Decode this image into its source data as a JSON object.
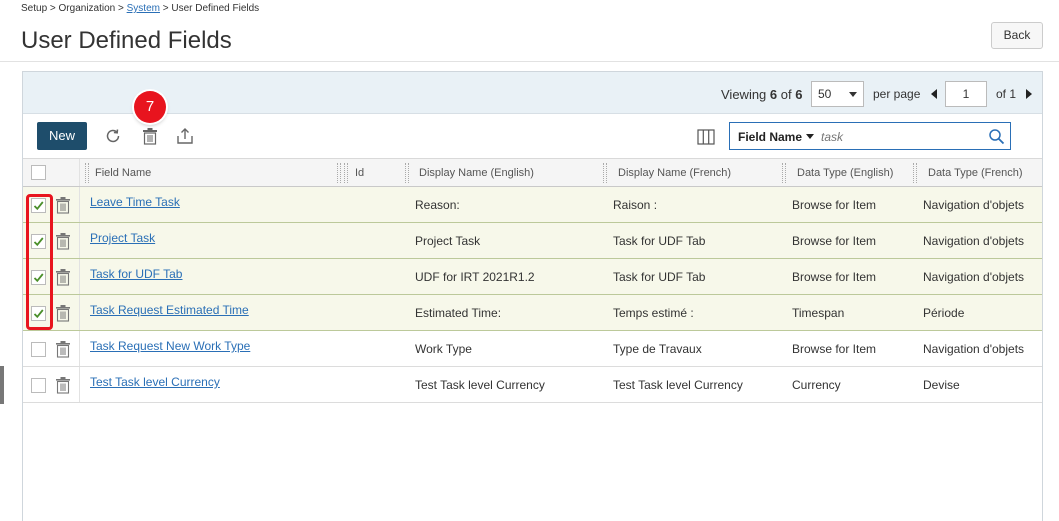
{
  "breadcrumb": {
    "part1": "Setup > Organization > ",
    "link": "System",
    "part2": " > User Defined Fields"
  },
  "page_title": "User Defined Fields",
  "back_label": "Back",
  "pager": {
    "viewing_prefix": "Viewing",
    "viewing_count": "6",
    "of_word": "of",
    "viewing_total": "6",
    "per_page_value": "50",
    "per_page_label": "per page",
    "page_value": "1",
    "of_pages": "of 1"
  },
  "toolbar": {
    "new_label": "New",
    "badge": "7",
    "icons": [
      "refresh-icon",
      "delete-icon",
      "export-icon",
      "columns-icon"
    ]
  },
  "search": {
    "field_label": "Field Name",
    "placeholder": "task"
  },
  "columns": [
    "Field Name",
    "Id",
    "Display Name (English)",
    "Display Name (French)",
    "Data Type (English)",
    "Data Type (French)"
  ],
  "rows": [
    {
      "selected": true,
      "field_name": "Leave Time Task",
      "id": "",
      "display_en": "Reason:",
      "display_fr": "Raison :",
      "type_en": "Browse for Item",
      "type_fr": "Navigation d'objets"
    },
    {
      "selected": true,
      "field_name": "Project Task",
      "id": "",
      "display_en": "Project Task",
      "display_fr": "Task for UDF Tab",
      "type_en": "Browse for Item",
      "type_fr": "Navigation d'objets"
    },
    {
      "selected": true,
      "field_name": "Task for UDF Tab",
      "id": "",
      "display_en": "UDF for IRT 2021R1.2",
      "display_fr": "Task for UDF Tab",
      "type_en": "Browse for Item",
      "type_fr": "Navigation d'objets"
    },
    {
      "selected": true,
      "field_name": "Task Request Estimated Time",
      "id": "",
      "display_en": "Estimated Time:",
      "display_fr": "Temps estimé :",
      "type_en": "Timespan",
      "type_fr": "Période"
    },
    {
      "selected": false,
      "field_name": "Task Request New Work Type",
      "id": "",
      "display_en": "Work Type",
      "display_fr": "Type de Travaux",
      "type_en": "Browse for Item",
      "type_fr": "Navigation d'objets"
    },
    {
      "selected": false,
      "field_name": "Test Task level Currency",
      "id": "",
      "display_en": "Test Task level Currency",
      "display_fr": "Test Task level Currency",
      "type_en": "Currency",
      "type_fr": "Devise"
    }
  ],
  "colors": {
    "accent": "#1e4d6b",
    "link": "#2a6fb6",
    "highlight": "#e8141e",
    "selected_row": "#f7f8ea"
  }
}
